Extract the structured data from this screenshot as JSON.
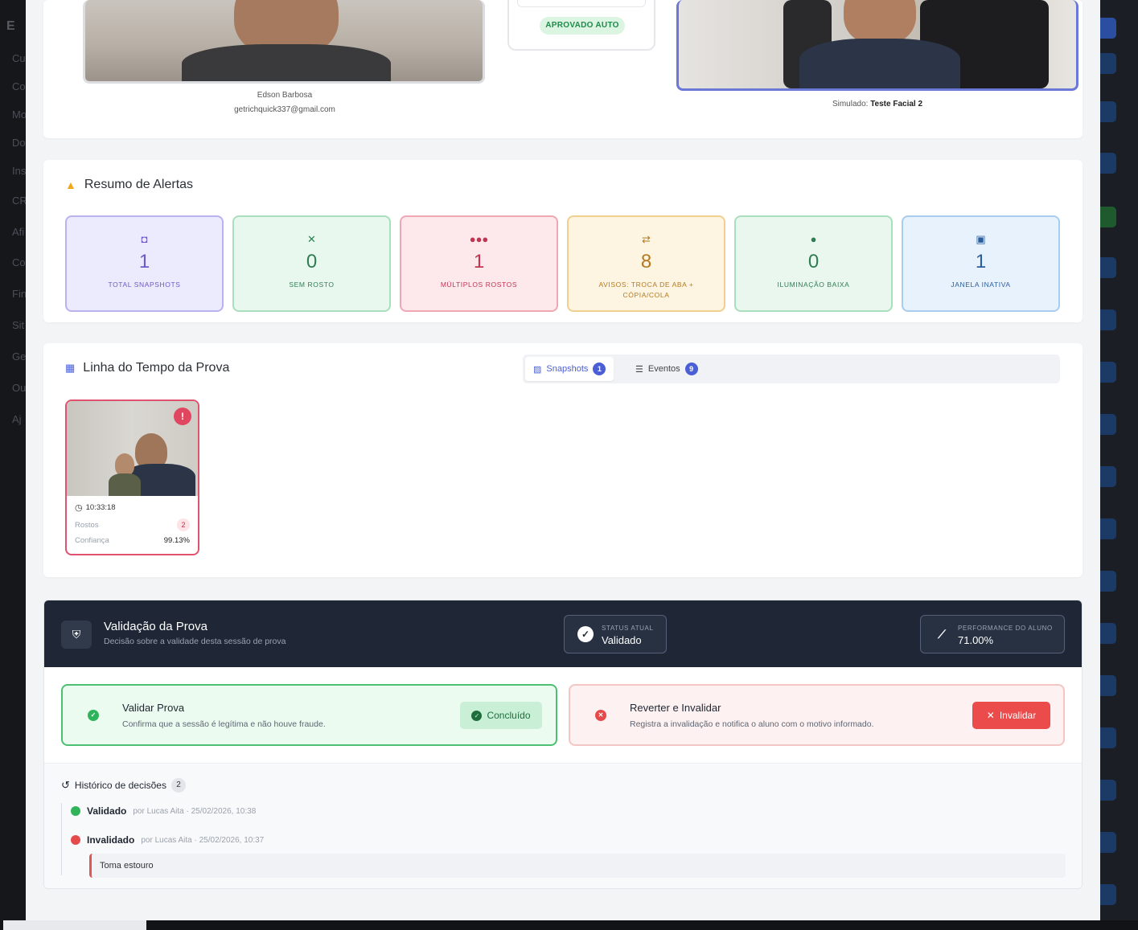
{
  "backdrop": {
    "logo": "E",
    "side_items": [
      "Cu",
      "Co",
      "Mo",
      "Do",
      "Ins",
      "CR",
      "Afi",
      "Co",
      "Fin",
      "Sit",
      "Ge",
      "Ou",
      "Aj"
    ]
  },
  "top": {
    "left_caption_name": "Edson Barbosa",
    "left_caption_email": "getrichquick337@gmail.com",
    "approved_badge": "APROVADO AUTO",
    "right_caption_prefix": "Simulado:",
    "right_caption_value": "Teste Facial 2"
  },
  "alerts": {
    "title": "Resumo de Alertas",
    "stats": [
      {
        "value": "1",
        "label": "TOTAL SNAPSHOTS",
        "icon": "camera-icon"
      },
      {
        "value": "0",
        "label": "SEM ROSTO",
        "icon": "user-slash-icon"
      },
      {
        "value": "1",
        "label": "MÚLTIPLOS ROSTOS",
        "icon": "users-icon"
      },
      {
        "value": "8",
        "label": "AVISOS: TROCA DE ABA + CÓPIA/COLA",
        "icon": "exchange-icon"
      },
      {
        "value": "0",
        "label": "ILUMINAÇÃO BAIXA",
        "icon": "lightbulb-icon"
      },
      {
        "value": "1",
        "label": "JANELA INATIVA",
        "icon": "window-icon"
      }
    ],
    "colors": {
      "purple": "#6f58c9",
      "green": "#2f7d53",
      "red": "#c23450",
      "orange": "#b4791f",
      "teal": "#2f7d53",
      "blue": "#2b5e9c"
    }
  },
  "timeline": {
    "title": "Linha do Tempo da Prova",
    "tab_snapshots": "Snapshots",
    "tab_snapshots_count": "1",
    "tab_events": "Eventos",
    "tab_events_count": "9",
    "snapshot": {
      "time": "10:33:18",
      "faces_label": "Rostos",
      "faces_value": "2",
      "confidence_label": "Confiança",
      "confidence_value": "99.13%"
    }
  },
  "validation": {
    "title": "Validação da Prova",
    "subtitle": "Decisão sobre a validade desta sessão de prova",
    "status_label": "STATUS ATUAL",
    "status_value": "Validado",
    "performance_label": "PERFORMANCE DO ALUNO",
    "performance_value": "71.00%",
    "validate_title": "Validar Prova",
    "validate_desc": "Confirma que a sessão é legítima e não houve fraude.",
    "validate_button": "Concluído",
    "invalidate_title": "Reverter e Invalidar",
    "invalidate_desc": "Registra a invalidação e notifica o aluno com o motivo informado.",
    "invalidate_button": "Invalidar",
    "history_title": "Histórico de decisões",
    "history_count": "2",
    "history": [
      {
        "status": "Validado",
        "meta": "por Lucas Aita · 25/02/2026, 10:38",
        "color": "#2fb45a"
      },
      {
        "status": "Invalidado",
        "meta": "por Lucas Aita · 25/02/2026, 10:37",
        "color": "#e54b4b"
      }
    ],
    "history_note": "Toma estouro"
  }
}
